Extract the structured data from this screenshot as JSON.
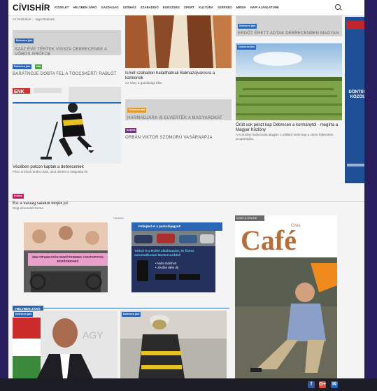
{
  "logo": "CÍVISHÍR",
  "nav": [
    "KÖZÉLET",
    "HELYBEN JÁRÓ",
    "GAZDASÁG",
    "SZÍNHÁZ",
    "SZABADIDŐ",
    "EGÉSZSÉG",
    "SPORT",
    "KULTÚRA",
    "SZÉPSÉG",
    "MÉDIA",
    "NAPI AJÁNLATUNK"
  ],
  "col1": {
    "top_text": "Az kézdokon ... egyeztetések",
    "item1": {
      "tag": "Debrecen járó",
      "title": "SZÁZ ÉVE TÉRTEK VISSZA DEBRECENBE A VÖRÖS GRÓFOK"
    },
    "item2": {
      "tag_a": "Debrecen járó",
      "tag_b": "Info",
      "title": "BARÁTNŐJE DOBTA FEL A TÖCCSKERTI RABLÓT"
    },
    "item3": {
      "title": "Vécében polcon kaptak a debreceniek",
      "desc": "Pénz is kívül rendet csak, ahol döntés a mágusba és"
    },
    "item4": {
      "tag": "Kultúra",
      "title": "Ezt a vastag salakot kérjük jó!",
      "desc": "Régi elmondott forma"
    }
  },
  "col2": {
    "item1": {
      "title": "Ismét szabadon haladhatnak Balmazújvárosra a kamionok",
      "desc": "Az irány a gazdasági tőke"
    },
    "item2": {
      "tag": "Debrecen járó",
      "title": "HARMADJÁRA IS ELVERTÉK A MAGYAROKAT"
    },
    "item3": {
      "tag": "Közélet",
      "title": "ORBÁN VIKTOR SZOMORÚ VASÁRNAPJA"
    }
  },
  "col3": {
    "item1": {
      "tag": "Debrecen járó",
      "title": "ERDŐT ÉRETT ADTAK DEBRECENBEN MAGYAN"
    },
    "item2": {
      "tag": "Debrecen járó",
      "title": "Őrült sok pénzt kap Debrecen a kormánytól - megírta a Magyar Közlöny",
      "desc": "A Kormány határozata alapján 1 milliárd forint kap a város fejlesztési programjára."
    }
  },
  "right_ad": {
    "headline": "DÖNTSÜNK KÖZÖSEN"
  },
  "section_ads_label": "Hirdetés",
  "ad1": {
    "text": "MULTIFUNKCIÓS EDZŐTERMEK CSOPORTOS EDZÉSEKHEZ"
  },
  "ad2": {
    "head": "Feltejted el a parkolójegyet!",
    "sub": "Töltsd le a Rollet alkalmazást, és fizess automatikusan Mastercarddal!",
    "b1": "• Nulla Üdéthvő",
    "b2": "• Jövőbe ülési díj"
  },
  "ad3": {
    "label": "DIVAT & OHLINE",
    "title": "Café",
    "sub": "Cívis"
  },
  "helyben": {
    "label": "HELYBEN JÁRÓ"
  },
  "social": [
    "f",
    "G+",
    "✉"
  ],
  "colors": {
    "accent": "#2b66b5",
    "bg": "#2a1f5e"
  }
}
